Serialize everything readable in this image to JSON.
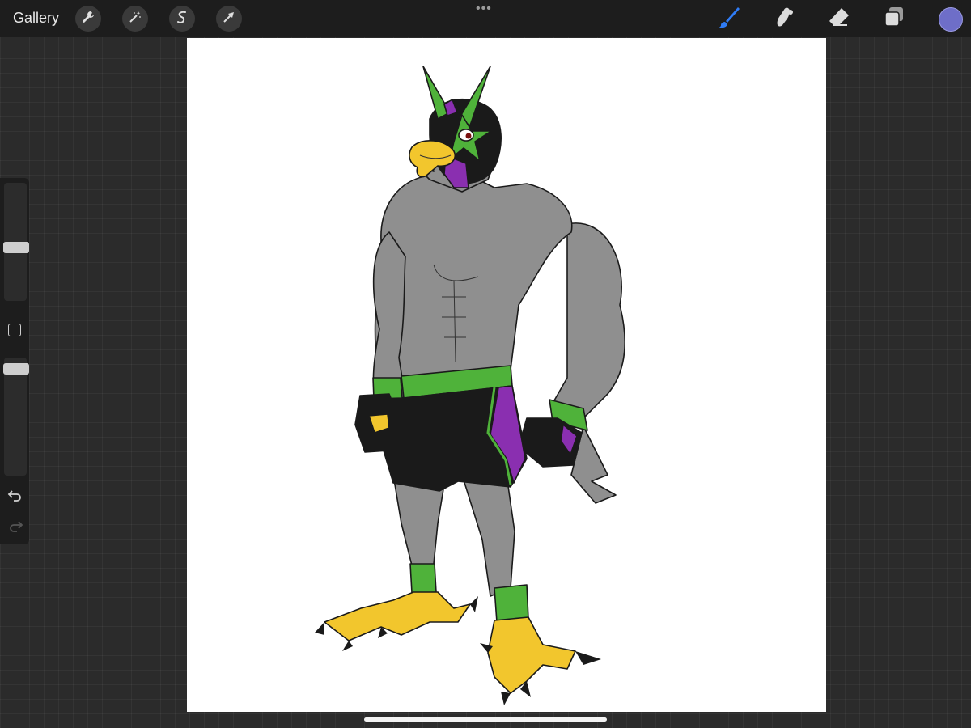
{
  "topbar": {
    "gallery_label": "Gallery",
    "left_tools": [
      "wrench-icon",
      "magic-wand-icon",
      "selection-icon",
      "transform-arrow-icon"
    ],
    "more_menu": "•••",
    "right_tools": [
      "brush-icon",
      "smudge-icon",
      "eraser-icon",
      "layers-icon"
    ],
    "active_tool": "brush",
    "current_color": "#6e6ec8"
  },
  "sidebar": {
    "brush_size_level": 0.45,
    "opacity_level": 0.05,
    "controls": [
      "modify-button",
      "undo-icon",
      "redo-icon"
    ]
  },
  "canvas": {
    "background": "#ffffff",
    "artwork": "falcon-wrestler-illustration",
    "palette": {
      "body": "#8f8f8f",
      "mask": "#1a1a1a",
      "accent": "#4fb23a",
      "trim": "#8a2fb0",
      "beak": "#f2c62d"
    }
  }
}
